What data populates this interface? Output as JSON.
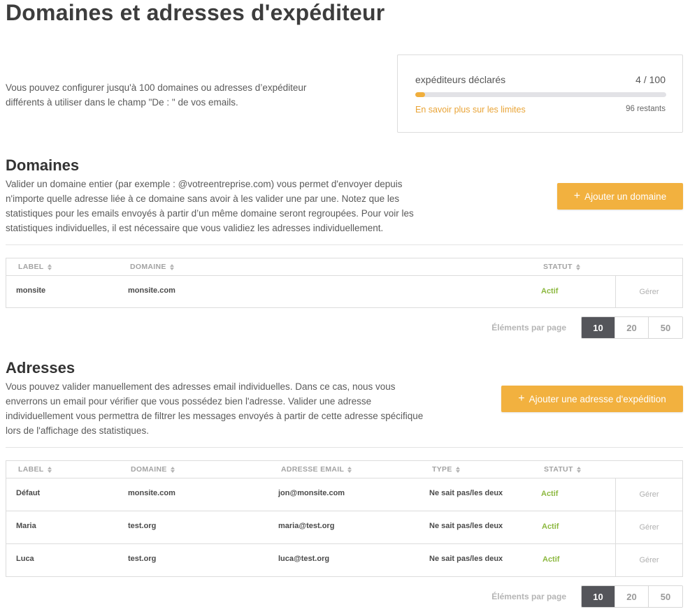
{
  "page": {
    "title": "Domaines et adresses d'expéditeur"
  },
  "intro": {
    "text": "Vous pouvez configurer jusqu'à 100 domaines ou adresses d’expéditeur différents à utiliser dans le champ \"De : \" de vos emails."
  },
  "quota": {
    "label": "expéditeurs déclarés",
    "count": "4 / 100",
    "used_fraction": 0.04,
    "link": "En savoir plus sur les limites",
    "remaining": "96 restants",
    "accent_color": "#f0ae3c"
  },
  "domains": {
    "title": "Domaines",
    "description": "Valider un domaine entier (par exemple : @votreentreprise.com) vous permet d'envoyer depuis n'importe quelle adresse liée à ce domaine sans avoir à les valider une par une. Notez que les statistiques pour les emails envoyés à partir d’un même domaine seront regroupées. Pour voir les statistiques individuelles, il est nécessaire que vous validiez les adresses individuellement.",
    "add_button": "Ajouter un domaine",
    "columns": {
      "label": "LABEL",
      "domain": "DOMAINE",
      "status": "STATUT"
    },
    "rows": [
      {
        "label": "monsite",
        "domain": "monsite.com",
        "status": "Actif",
        "manage": "Gérer"
      }
    ],
    "pager": {
      "label": "Éléments par page",
      "options": [
        "10",
        "20",
        "50"
      ],
      "selected": "10"
    }
  },
  "addresses": {
    "title": "Adresses",
    "description": "Vous pouvez valider manuellement des adresses email individuelles. Dans ce cas, nous vous enverrons un email pour vérifier que vous possédez bien l'adresse. Valider une adresse individuellement vous permettra de filtrer les messages envoyés à partir de cette adresse spécifique lors de l'affichage des statistiques.",
    "add_button": "Ajouter une adresse d'expédition",
    "columns": {
      "label": "LABEL",
      "domain": "DOMAINE",
      "email": "ADRESSE EMAIL",
      "type": "TYPE",
      "status": "STATUT"
    },
    "rows": [
      {
        "label": "Défaut",
        "domain": "monsite.com",
        "email": "jon@monsite.com",
        "type": "Ne sait pas/les deux",
        "status": "Actif",
        "manage": "Gérer"
      },
      {
        "label": "Maria",
        "domain": "test.org",
        "email": "maria@test.org",
        "type": "Ne sait pas/les deux",
        "status": "Actif",
        "manage": "Gérer"
      },
      {
        "label": "Luca",
        "domain": "test.org",
        "email": "luca@test.org",
        "type": "Ne sait pas/les deux",
        "status": "Actif",
        "manage": "Gérer"
      }
    ],
    "pager": {
      "label": "Éléments par page",
      "options": [
        "10",
        "20",
        "50"
      ],
      "selected": "10"
    }
  },
  "colors": {
    "primary_button": "#f2b13f",
    "status_active": "#8cb83f",
    "pager_active": "#54555a"
  },
  "icons": {
    "sort": "sort-icon",
    "add": "plus-icon"
  }
}
